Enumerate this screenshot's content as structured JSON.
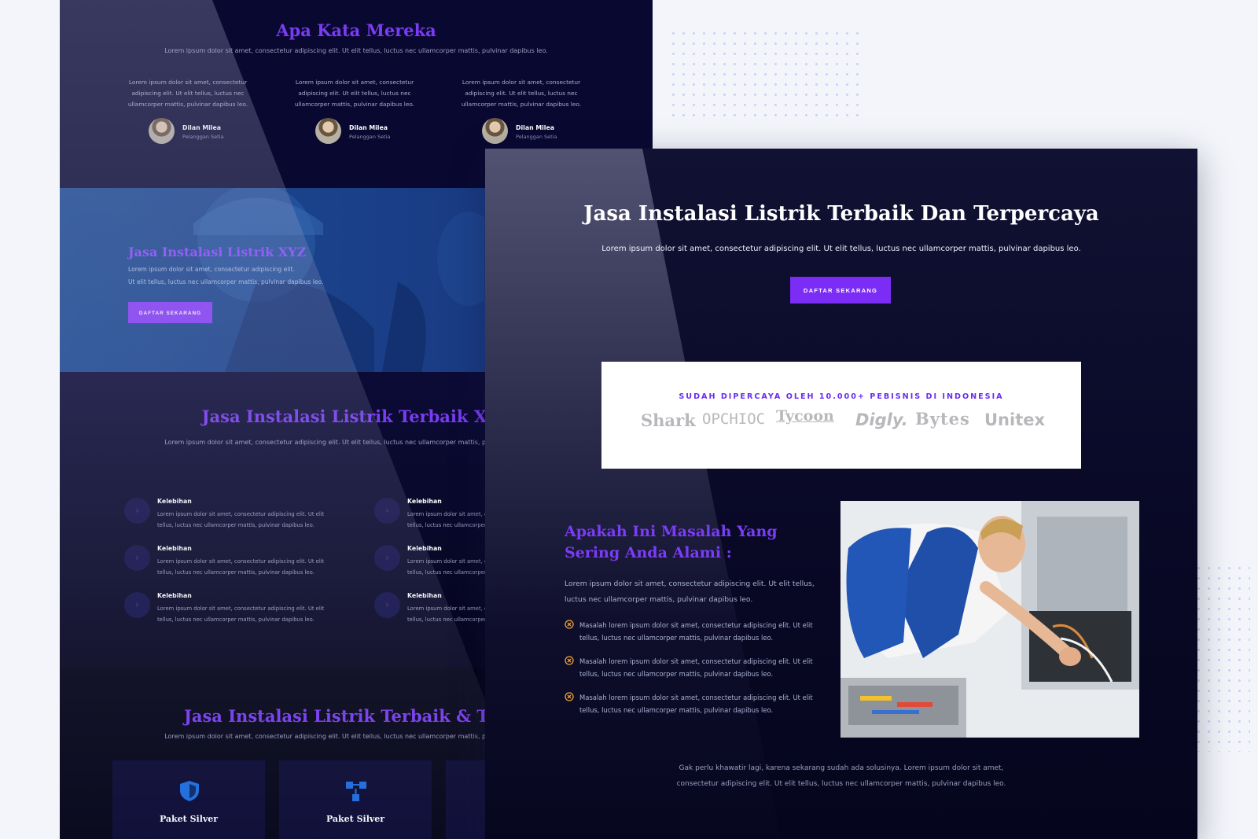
{
  "back_page": {
    "testimonials": {
      "title": "Apa Kata Mereka",
      "subtitle": "Lorem ipsum dolor sit amet, consectetur adipiscing elit. Ut elit tellus, luctus nec ullamcorper mattis, pulvinar dapibus leo.",
      "items": [
        {
          "quote": "Lorem ipsum dolor sit amet, consectetur adipiscing elit. Ut elit tellus, luctus nec ullamcorper mattis, pulvinar dapibus leo.",
          "name": "Dilan Milea",
          "role": "Pelanggan Setia"
        },
        {
          "quote": "Lorem ipsum dolor sit amet, consectetur adipiscing elit. Ut elit tellus, luctus nec ullamcorper mattis, pulvinar dapibus leo.",
          "name": "Dilan Milea",
          "role": "Pelanggan Setia"
        },
        {
          "quote": "Lorem ipsum dolor sit amet, consectetur adipiscing elit. Ut elit tellus, luctus nec ullamcorper mattis, pulvinar dapibus leo.",
          "name": "Dilan Milea",
          "role": "Pelanggan Setia"
        }
      ]
    },
    "hero": {
      "title": "Jasa Instalasi Listrik XYZ",
      "line1": "Lorem ipsum dolor sit amet, consectetur adipiscing elit.",
      "line2": "Ut elit tellus, luctus nec ullamcorper mattis, pulvinar dapibus leo.",
      "button": "DAFTAR SEKARANG"
    },
    "features": {
      "title": "Jasa Instalasi Listrik Terbaik XYZ",
      "subtitle": "Lorem ipsum dolor sit amet, consectetur adipiscing elit. Ut elit tellus, luctus nec ullamcorper mattis, pulvinar dapibus leo.",
      "items": [
        {
          "title": "Kelebihan",
          "text": "Lorem ipsum dolor sit amet, consectetur adipiscing elit. Ut elit tellus, luctus nec ullamcorper mattis, pulvinar dapibus leo."
        },
        {
          "title": "Kelebihan",
          "text": "Lorem ipsum dolor sit amet, consectetur adipiscing elit. Ut elit tellus, luctus nec ullamcorper mattis, pulvinar dapibus leo."
        },
        {
          "title": "Kelebihan",
          "text": "Lorem ipsum dolor sit amet, consectetur adipiscing elit. Ut elit tellus, luctus nec ullamcorper mattis, pulvinar dapibus leo."
        },
        {
          "title": "Kelebihan",
          "text": "Lorem ipsum dolor sit amet, consectetur adipiscing elit. Ut elit tellus, luctus nec ullamcorper mattis, pulvinar dapibus leo."
        },
        {
          "title": "Kelebihan",
          "text": "Lorem ipsum dolor sit amet, consectetur adipiscing elit. Ut elit tellus, luctus nec ullamcorper mattis, pulvinar dapibus leo."
        },
        {
          "title": "Kelebihan",
          "text": "Lorem ipsum dolor sit amet, consectetur adipiscing elit. Ut elit tellus, luctus nec ullamcorper mattis, pulvinar dapibus leo."
        }
      ]
    },
    "pricing": {
      "title": "Jasa Instalasi Listrik Terbaik & Terpe",
      "subtitle": "Lorem ipsum dolor sit amet, consectetur adipiscing elit. Ut elit tellus, luctus nec ullamcorper mattis, pulvinar dapibus leo.",
      "cards": [
        {
          "name": "Paket Silver",
          "icon": "shield-icon"
        },
        {
          "name": "Paket Silver",
          "icon": "network-icon"
        }
      ]
    }
  },
  "front_page": {
    "title": "Jasa Instalasi Listrik Terbaik Dan Terpercaya",
    "subtitle": "Lorem ipsum dolor sit amet, consectetur adipiscing elit. Ut elit tellus, luctus nec ullamcorper mattis, pulvinar dapibus leo.",
    "button": "DAFTAR SEKARANG",
    "trust": {
      "label": "SUDAH DIPERCAYA OLEH 10.000+ PEBISNIS DI INDONESIA",
      "logos": [
        "Shark",
        "OPCHIOC",
        "Tycoon",
        "Digly.",
        "Bytes",
        "Unitex"
      ]
    },
    "problem_title": "Apakah Ini Masalah Yang Sering Anda Alami :",
    "problem_intro": "Lorem ipsum dolor sit amet, consectetur adipiscing elit. Ut elit tellus, luctus nec ullamcorper mattis, pulvinar dapibus leo.",
    "problems": [
      "Masalah lorem ipsum dolor sit amet, consectetur adipiscing elit. Ut elit tellus, luctus nec ullamcorper mattis, pulvinar dapibus leo.",
      "Masalah lorem ipsum dolor sit amet, consectetur adipiscing elit. Ut elit tellus, luctus nec ullamcorper mattis, pulvinar dapibus leo.",
      "Masalah lorem ipsum dolor sit amet, consectetur adipiscing elit. Ut elit tellus, luctus nec ullamcorper mattis, pulvinar dapibus leo."
    ],
    "footer_line1": "Gak perlu khawatir lagi, karena sekarang sudah ada solusinya. Lorem ipsum dolor sit amet,",
    "footer_line2": "consectetur adipiscing elit. Ut elit tellus, luctus nec ullamcorper mattis, pulvinar dapibus leo."
  },
  "colors": {
    "accent_purple": "#7b2cf5",
    "heading_purple": "#7a3cf2",
    "navy_bg": "#060626",
    "problem_icon_orange": "#f0a030"
  }
}
